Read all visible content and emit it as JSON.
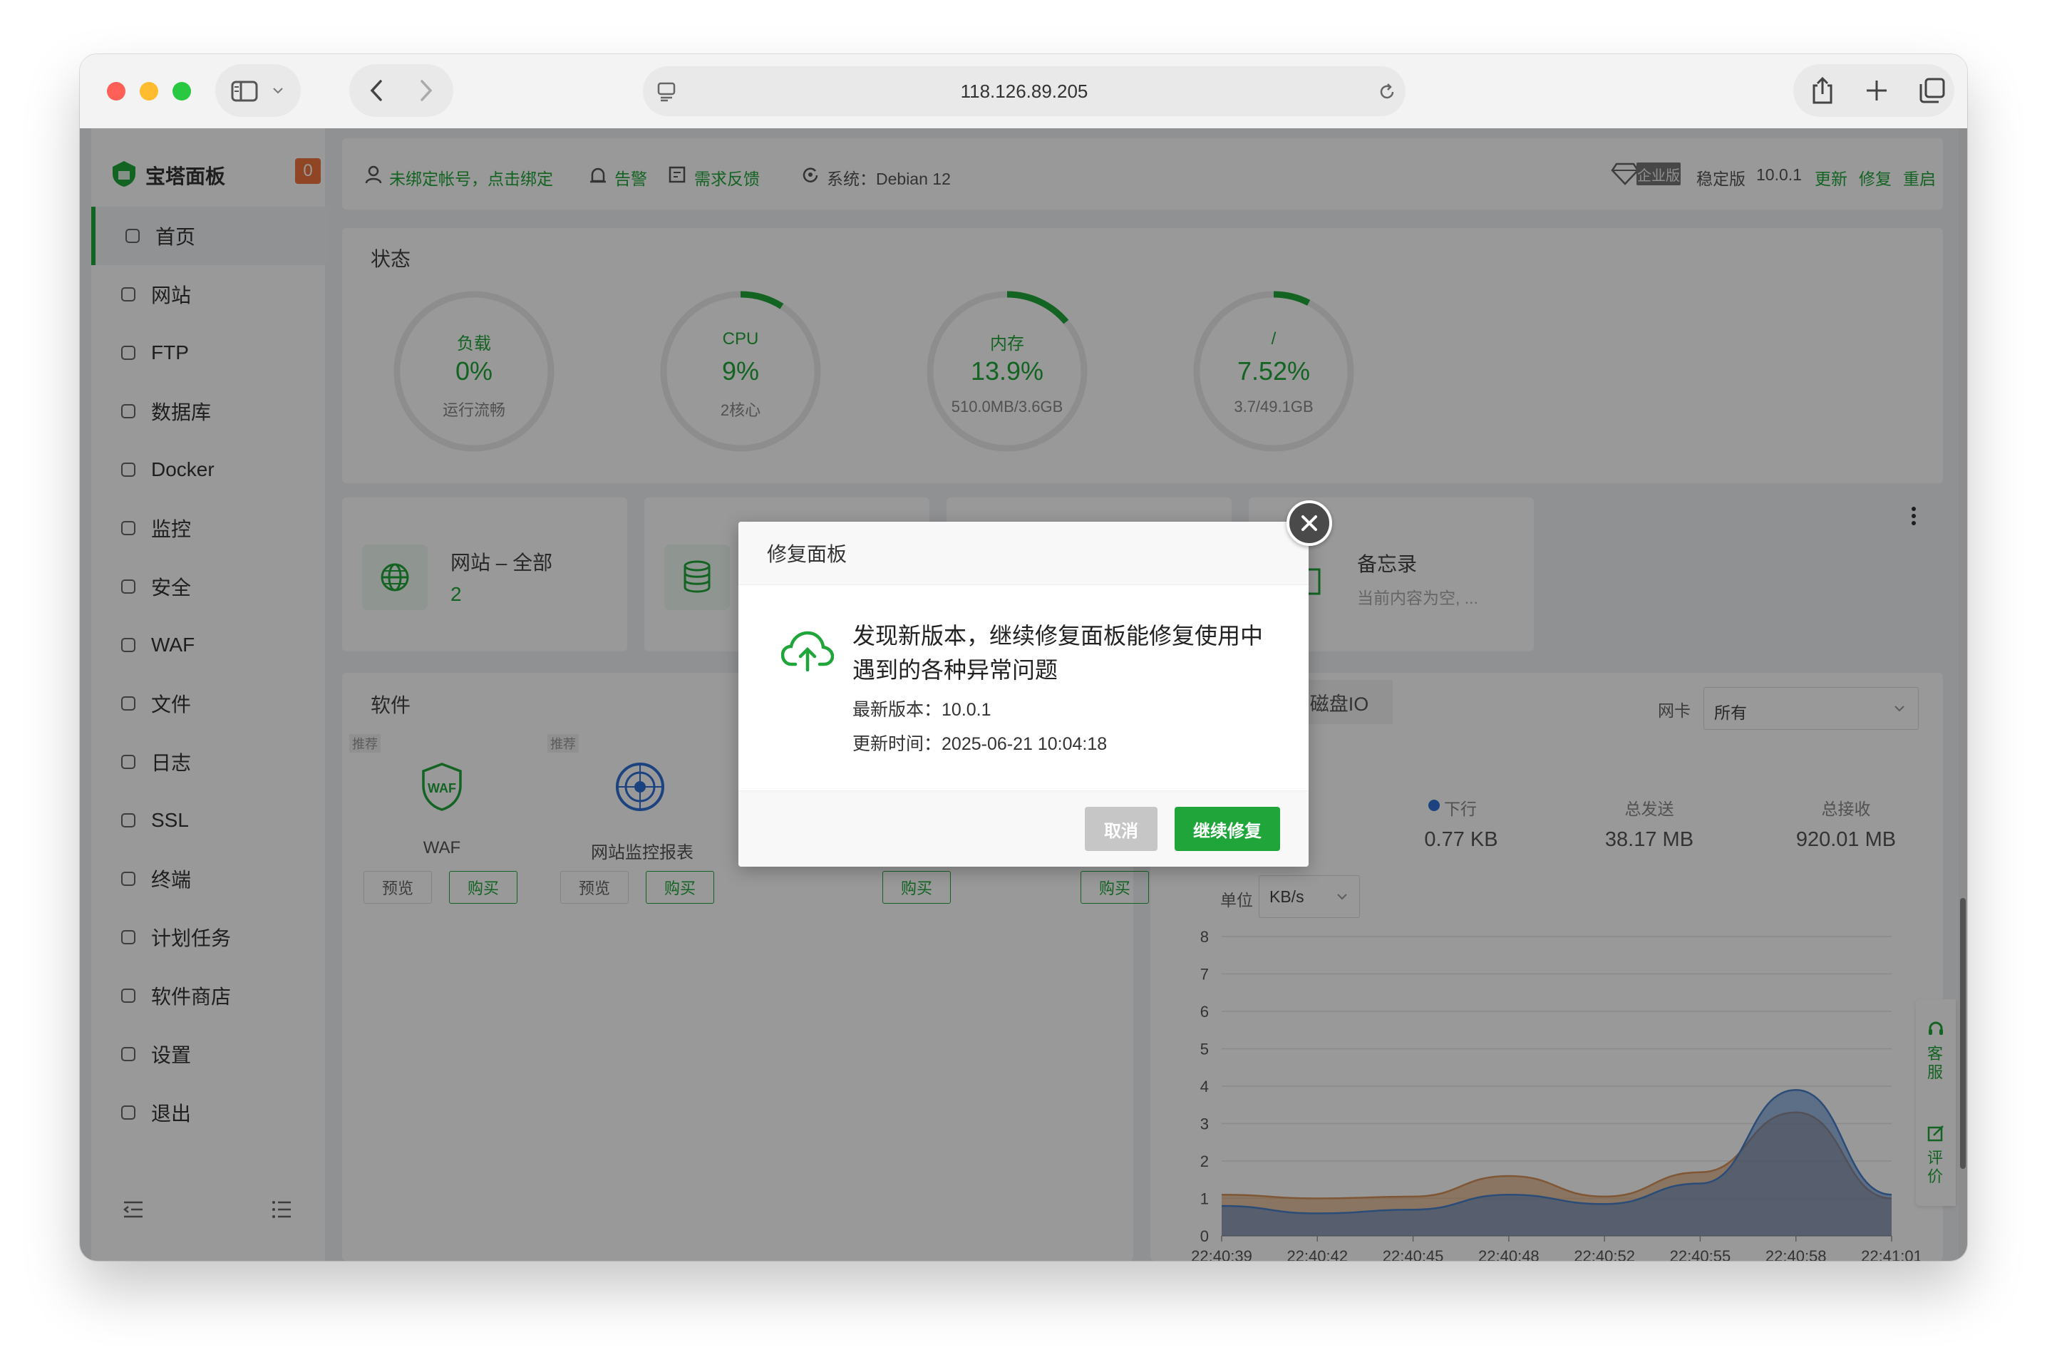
{
  "browser": {
    "url": "118.126.89.205"
  },
  "sidebar": {
    "brand": "宝塔面板",
    "badge": "0",
    "items": [
      {
        "label": "首页",
        "icon": "home-icon"
      },
      {
        "label": "网站",
        "icon": "globe-icon"
      },
      {
        "label": "FTP",
        "icon": "globe-icon"
      },
      {
        "label": "数据库",
        "icon": "database-icon"
      },
      {
        "label": "Docker",
        "icon": "docker-icon"
      },
      {
        "label": "监控",
        "icon": "monitor-icon"
      },
      {
        "label": "安全",
        "icon": "shield-icon"
      },
      {
        "label": "WAF",
        "icon": "waf-icon"
      },
      {
        "label": "文件",
        "icon": "folder-icon"
      },
      {
        "label": "日志",
        "icon": "log-icon"
      },
      {
        "label": "SSL",
        "icon": "ssl-icon"
      },
      {
        "label": "终端",
        "icon": "terminal-icon"
      },
      {
        "label": "计划任务",
        "icon": "calendar-icon"
      },
      {
        "label": "软件商店",
        "icon": "apps-icon"
      },
      {
        "label": "设置",
        "icon": "gear-icon"
      },
      {
        "label": "退出",
        "icon": "logout-icon"
      }
    ]
  },
  "topbar": {
    "account": "未绑定帐号，点击绑定",
    "alert": "告警",
    "feedback": "需求反馈",
    "system": "系统：Debian 12",
    "enterprise": "企业版",
    "stable": "稳定版",
    "version": "10.0.1",
    "update": "更新",
    "repair": "修复",
    "restart": "重启"
  },
  "status": {
    "title": "状态",
    "gauges": [
      {
        "label": "负载",
        "value": "0%",
        "sub": "运行流畅",
        "percent": 0
      },
      {
        "label": "CPU",
        "value": "9%",
        "sub": "2核心",
        "percent": 9
      },
      {
        "label": "内存",
        "value": "13.9%",
        "sub": "510.0MB/3.6GB",
        "percent": 13.9
      },
      {
        "label": "/",
        "value": "7.52%",
        "sub": "3.7/49.1GB",
        "percent": 7.52
      }
    ]
  },
  "overview": {
    "site_label": "网站 – 全部",
    "site_count": "2",
    "memo_label": "备忘录",
    "memo_text": "当前内容为空, ..."
  },
  "software": {
    "title": "软件",
    "tag": "推荐",
    "items": [
      {
        "name": "WAF",
        "preview": "预览",
        "buy": "购买"
      },
      {
        "name": "网站监控报表",
        "preview": "预览",
        "buy": "购买"
      }
    ],
    "buy": "购买"
  },
  "traffic": {
    "tab": "磁盘IO",
    "nic_label": "网卡",
    "nic_value": "所有",
    "down_label": "下行",
    "down_value": "0.77 KB",
    "sent_label": "总发送",
    "sent_value": "38.17 MB",
    "recv_label": "总接收",
    "recv_value": "920.01 MB",
    "unit_label": "单位",
    "unit_value": "KB/s"
  },
  "side_tools": {
    "service": "客服",
    "review": "评价"
  },
  "chart_data": {
    "type": "area",
    "x": [
      "22:40:39",
      "22:40:42",
      "22:40:45",
      "22:40:48",
      "22:40:52",
      "22:40:55",
      "22:40:58",
      "22:41:01"
    ],
    "yticks": [
      0,
      1,
      2,
      3,
      4,
      5,
      6,
      7,
      8
    ],
    "ylim": [
      0,
      8
    ],
    "series": [
      {
        "values": [
          1.1,
          1.0,
          1.05,
          1.6,
          1.05,
          1.7,
          3.3,
          1.0
        ],
        "color": "#d4925a"
      },
      {
        "values": [
          0.8,
          0.6,
          0.7,
          1.1,
          0.85,
          1.4,
          3.9,
          1.1
        ],
        "color": "#4a7fc8"
      }
    ]
  },
  "modal": {
    "title": "修复面板",
    "message": "发现新版本，继续修复面板能修复使用中遇到的各种异常问题",
    "message_line1": "发现新版本，继续修复面板能修复使用中",
    "message_line2": "遇到的各种异常问题",
    "latest_label": "最新版本：",
    "latest_value": "10.0.1",
    "time_label": "更新时间：",
    "time_value": "2025-06-21 10:04:18",
    "cancel": "取消",
    "confirm": "继续修复"
  }
}
